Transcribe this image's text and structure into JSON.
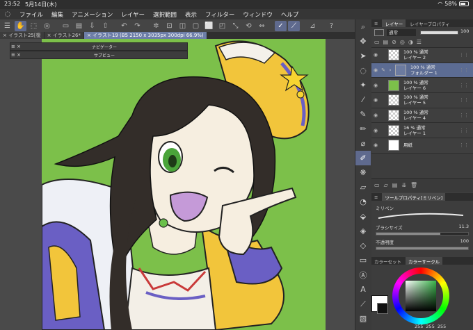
{
  "status": {
    "time": "23:52",
    "date": "5月14日(木)",
    "battery": "58%"
  },
  "menu": [
    "ファイル",
    "編集",
    "アニメーション",
    "レイヤー",
    "選択範囲",
    "表示",
    "フィルター",
    "ウィンドウ",
    "ヘルプ"
  ],
  "tabs": [
    "× イラスト25[復",
    "× イラスト26*",
    "× イラスト19 (B5 2150 x 3035px 300dpi 66.9%)"
  ],
  "float_panels": {
    "navigator": "ナビゲーター",
    "subview": "サブビュー"
  },
  "layer_panel": {
    "tab_layer": "レイヤー",
    "tab_props": "レイヤープロパティ",
    "blend": "通常",
    "opacity": "100",
    "layers": [
      {
        "line1": "100 % 通常",
        "line2": "レイヤー 2",
        "thumb": "chk"
      },
      {
        "line1": "100 % 通常",
        "line2": "フォルダー 1",
        "thumb": "folder",
        "selected": true
      },
      {
        "line1": "100 % 通常",
        "line2": "レイヤー 6",
        "thumb": "grn"
      },
      {
        "line1": "100 % 通常",
        "line2": "レイヤー 5",
        "thumb": "chk"
      },
      {
        "line1": "100 % 通常",
        "line2": "レイヤー 4",
        "thumb": "chk"
      },
      {
        "line1": "16 % 通常",
        "line2": "レイヤー 1",
        "thumb": "chk"
      },
      {
        "line1": "",
        "line2": "用紙",
        "thumb": "wht"
      }
    ]
  },
  "tool_property": {
    "header": "ツールプロパティ[ミリペン]",
    "tool_name": "ミリペン",
    "brush_size_label": "ブラシサイズ",
    "brush_size": "11.3",
    "opacity_label": "不透明度",
    "opacity": "100"
  },
  "color": {
    "tab_set": "カラーセット",
    "tab_circle": "カラーサークル",
    "values": [
      "255",
      "255",
      "255"
    ]
  }
}
